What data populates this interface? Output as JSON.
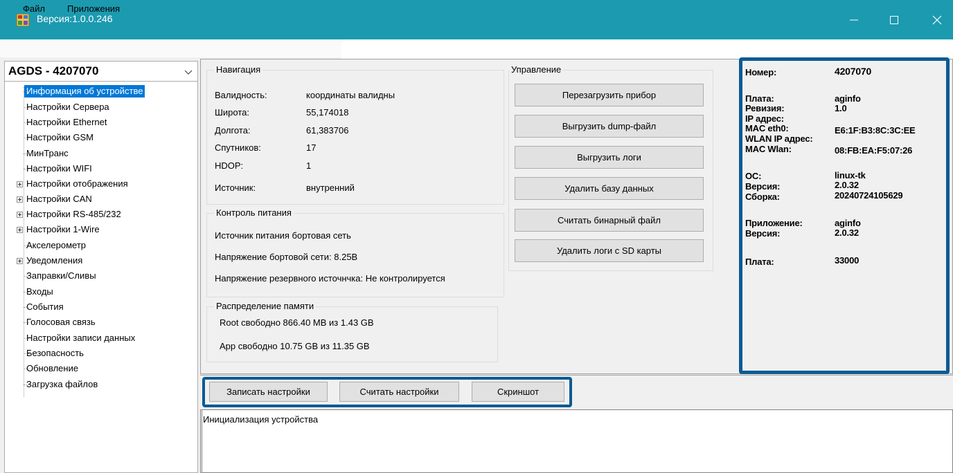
{
  "window": {
    "title": "Версия:1.0.0.246"
  },
  "menu": {
    "file": "Файл",
    "apps": "Приложения"
  },
  "device": {
    "selected": "AGDS - 4207070"
  },
  "tree": {
    "items": [
      "Информация об устройстве",
      "Настройки Сервера",
      "Настройки Ethernet",
      "Настройки GSM",
      "МинТранс",
      "Настройки WIFI",
      "Настройки отображения",
      "Настройки CAN",
      "Настройки RS-485/232",
      "Настройки 1-Wire",
      "Акселерометр",
      "Уведомления",
      "Заправки/Сливы",
      "Входы",
      "События",
      "Голосовая связь",
      "Настройки записи данных",
      "Безопасность",
      "Обновление",
      "Загрузка файлов"
    ]
  },
  "navigation": {
    "title": "Навигация",
    "validity_label": "Валидность:",
    "validity_value": "координаты валидны",
    "lat_label": "Широта:",
    "lat_value": "55,174018",
    "lon_label": "Долгота:",
    "lon_value": "61,383706",
    "sats_label": "Спутников:",
    "sats_value": "17",
    "hdop_label": "HDOP:",
    "hdop_value": "1",
    "source_label": "Источник:",
    "source_value": "внутренний"
  },
  "power": {
    "title": "Контроль питания",
    "source": "Источник питания   бортовая сеть",
    "voltage": "Напряжение бортовой сети:   8.25В",
    "backup": "Напряжение резервного источнчка:   Не контролируется"
  },
  "memory": {
    "title": "Распределение памяти",
    "root": "Root свободно 866.40 MB из 1.43 GB",
    "app": "App свободно 10.75 GB из 11.35 GB"
  },
  "control": {
    "title": "Управление",
    "reboot": "Перезагрузить прибор",
    "dump": "Выгрузить dump-файл",
    "logs": "Выгрузить логи",
    "delete_db": "Удалить базу данных",
    "read_bin": "Считать бинарный файл",
    "delete_sd": "Удалить логи с SD карты"
  },
  "info": {
    "number_label": "Номер:",
    "number_value": "4207070",
    "board_label": "Плата:",
    "board_value": "aginfo",
    "revision_label": "Ревизия:",
    "revision_value": "1.0",
    "ip_label": "IP адрес:",
    "mac_eth_label": "MAC eth0:",
    "mac_eth_value": "E6:1F:B3:8C:3C:EE",
    "wlan_ip_label": "WLAN IP адрес:",
    "mac_wlan_label": "MAC Wlan:",
    "mac_wlan_value": "08:FB:EA:F5:07:26",
    "os_label": "ОС:",
    "os_value": "linux-tk",
    "os_version_label": "Версия:",
    "os_version_value": "2.0.32",
    "build_label": "Сборка:",
    "build_value": "20240724105629",
    "app_label": "Приложение:",
    "app_value": "aginfo",
    "app_version_label": "Версия:",
    "app_version_value": "2.0.32",
    "board2_label": "Плата:",
    "board2_value": "33000"
  },
  "bottom": {
    "write": "Записать настройки",
    "read": "Считать настройки",
    "screenshot": "Скриншот"
  },
  "log": {
    "text": "Инициализация устройства"
  },
  "colors": {
    "titlebar": "#1c9ab0",
    "highlight": "#0a5a94",
    "selection": "#0078d7"
  }
}
